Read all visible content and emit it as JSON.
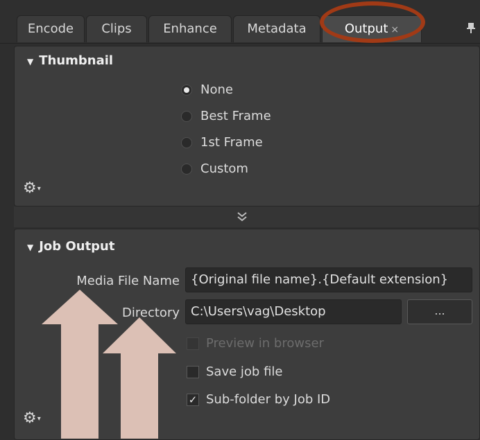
{
  "tabs": [
    {
      "label": "Encode",
      "active": false
    },
    {
      "label": "Clips",
      "active": false
    },
    {
      "label": "Enhance",
      "active": false
    },
    {
      "label": "Metadata",
      "active": false
    },
    {
      "label": "Output",
      "active": true,
      "close": "×"
    }
  ],
  "thumbnail": {
    "title": "Thumbnail",
    "options": [
      "None",
      "Best Frame",
      "1st Frame",
      "Custom"
    ],
    "selected": "None"
  },
  "collapse_glyph": "≚",
  "job_output": {
    "title": "Job Output",
    "media_file_name_label": "Media File Name",
    "media_file_name_value": "{Original file name}.{Default extension}",
    "directory_label": "Directory",
    "directory_value": "C:\\Users\\vag\\Desktop",
    "browse_label": "...",
    "checkboxes": [
      {
        "label": "Preview in browser",
        "checked": false,
        "enabled": false
      },
      {
        "label": "Save job file",
        "checked": false,
        "enabled": true
      },
      {
        "label": "Sub-folder by Job ID",
        "checked": true,
        "enabled": true
      }
    ]
  },
  "colors": {
    "annotation_oval": "#a13a16",
    "annotation_arrows": "#dcc0b5"
  },
  "icons": [
    "gear-icon",
    "pin-icon",
    "close-icon",
    "collapse-chevrons-icon"
  ]
}
